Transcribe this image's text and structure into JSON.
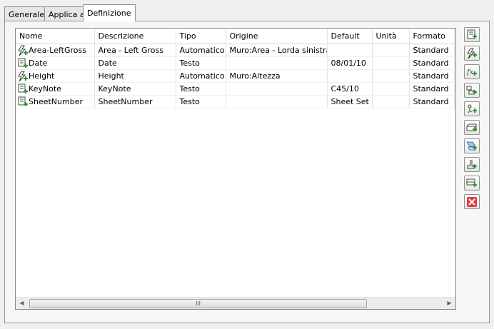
{
  "tabs": [
    {
      "label": "Generale"
    },
    {
      "label": "Applica a"
    },
    {
      "label": "Definizione",
      "active": true
    }
  ],
  "table": {
    "columns": [
      "Nome",
      "Descrizione",
      "Tipo",
      "Origine",
      "Default",
      "Unità",
      "Formato"
    ],
    "rows": [
      {
        "icon": "automatic-property-icon",
        "name": "Area-LeftGross",
        "descrizione": "Area - Left Gross",
        "tipo": "Automatico",
        "origine": "Muro:Area - Lorda sinistra",
        "default": "",
        "unita": "",
        "formato": "Standard"
      },
      {
        "icon": "text-property-icon",
        "name": "Date",
        "descrizione": "Date",
        "tipo": "Testo",
        "origine": "",
        "default": "08/01/10",
        "unita": "",
        "formato": "Standard"
      },
      {
        "icon": "automatic-property-icon",
        "name": "Height",
        "descrizione": "Height",
        "tipo": "Automatico",
        "origine": "Muro:Altezza",
        "default": "",
        "unita": "",
        "formato": "Standard"
      },
      {
        "icon": "text-property-icon",
        "name": "KeyNote",
        "descrizione": "KeyNote",
        "tipo": "Testo",
        "origine": "",
        "default": "C45/10",
        "unita": "",
        "formato": "Standard"
      },
      {
        "icon": "text-property-icon",
        "name": "SheetNumber",
        "descrizione": "SheetNumber",
        "tipo": "Testo",
        "origine": "",
        "default": "Sheet Set",
        "unita": "",
        "formato": "Standard"
      }
    ]
  },
  "scrollbar": {
    "thumb_grip": "III"
  },
  "toolbar": [
    "add-manual-property-icon",
    "add-automatic-property-icon",
    "add-formula-property-icon",
    "add-anchor-property-icon",
    "add-location-property-icon",
    "add-classification-property-icon",
    "add-material-property-icon",
    "add-graphic-property-icon",
    "add-list-property-icon",
    "delete-property-icon"
  ]
}
